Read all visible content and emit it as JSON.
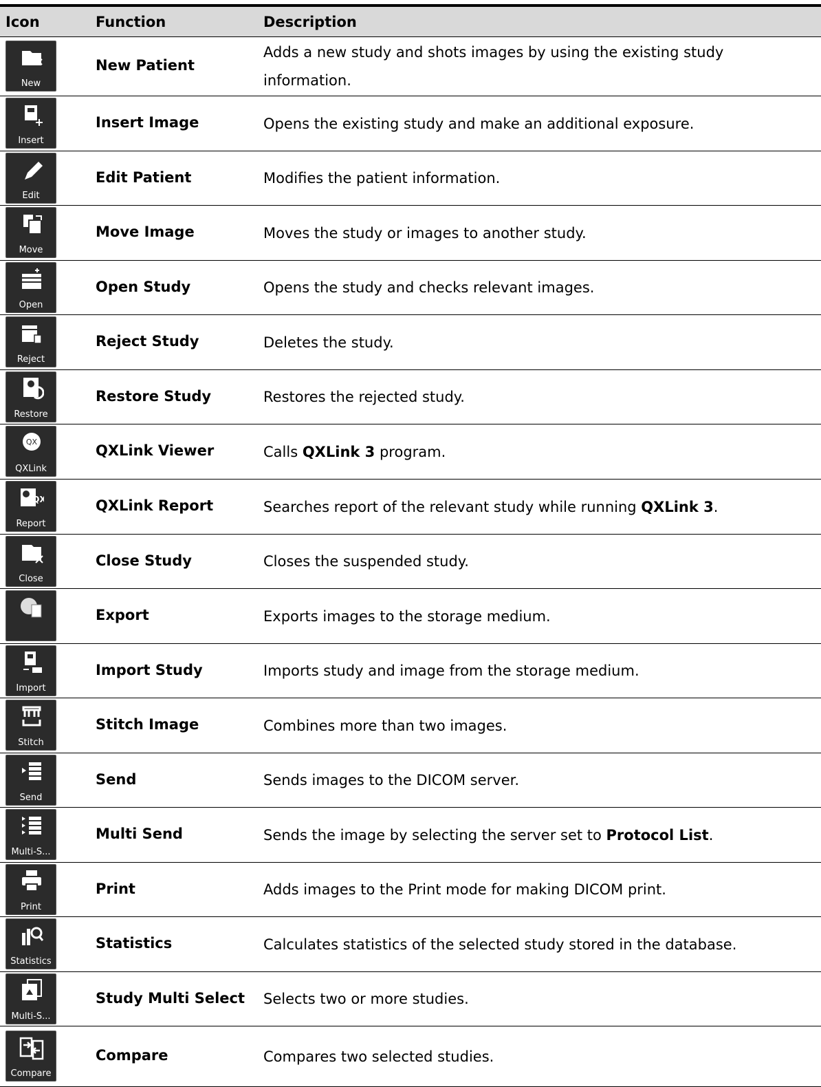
{
  "header": {
    "icon": "Icon",
    "function": "Function",
    "description": "Description"
  },
  "rows": [
    {
      "icon": "new-patient-icon",
      "icon_label": "New",
      "function": "New Patient",
      "desc": [
        {
          "t": "Adds a new study and shots images by using the existing study information.",
          "b": false
        }
      ]
    },
    {
      "icon": "insert-image-icon",
      "icon_label": "Insert",
      "function": "Insert Image",
      "desc": [
        {
          "t": "Opens the existing study and make an additional exposure.",
          "b": false
        }
      ]
    },
    {
      "icon": "edit-icon",
      "icon_label": "Edit",
      "function": "Edit Patient",
      "desc": [
        {
          "t": "Modifies the patient information.",
          "b": false
        }
      ]
    },
    {
      "icon": "move-image-icon",
      "icon_label": "Move",
      "function": "Move Image",
      "desc": [
        {
          "t": "Moves the study or images to another study.",
          "b": false
        }
      ]
    },
    {
      "icon": "open-study-icon",
      "icon_label": "Open",
      "function": "Open Study",
      "desc": [
        {
          "t": "Opens the study and checks relevant images.",
          "b": false
        }
      ]
    },
    {
      "icon": "reject-study-icon",
      "icon_label": "Reject",
      "function": "Reject Study",
      "desc": [
        {
          "t": "Deletes the study.",
          "b": false
        }
      ]
    },
    {
      "icon": "restore-study-icon",
      "icon_label": "Restore",
      "function": "Restore Study",
      "desc": [
        {
          "t": "Restores the rejected study.",
          "b": false
        }
      ]
    },
    {
      "icon": "qxlink-viewer-icon",
      "icon_label": "QXLink",
      "function": "QXLink Viewer",
      "desc": [
        {
          "t": "Calls ",
          "b": false
        },
        {
          "t": "QXLink 3",
          "b": true
        },
        {
          "t": " program.",
          "b": false
        }
      ]
    },
    {
      "icon": "qxlink-report-icon",
      "icon_label": "Report",
      "function": "QXLink Report",
      "desc": [
        {
          "t": "Searches report of the relevant study while running ",
          "b": false
        },
        {
          "t": "QXLink 3",
          "b": true
        },
        {
          "t": ".",
          "b": false
        }
      ]
    },
    {
      "icon": "close-study-icon",
      "icon_label": "Close",
      "function": "Close Study",
      "desc": [
        {
          "t": "Closes the suspended study.",
          "b": false
        }
      ]
    },
    {
      "icon": "export-icon",
      "icon_label": "",
      "function": "Export",
      "desc": [
        {
          "t": "Exports images to the storage medium.",
          "b": false
        }
      ]
    },
    {
      "icon": "import-study-icon",
      "icon_label": "Import",
      "function": "Import Study",
      "desc": [
        {
          "t": "Imports study and image from the storage medium.",
          "b": false
        }
      ]
    },
    {
      "icon": "stitch-image-icon",
      "icon_label": "Stitch",
      "function": "Stitch Image",
      "desc": [
        {
          "t": "Combines more than two images.",
          "b": false
        }
      ]
    },
    {
      "icon": "send-icon",
      "icon_label": "Send",
      "function": "Send",
      "desc": [
        {
          "t": "Sends images to the DICOM server.",
          "b": false
        }
      ]
    },
    {
      "icon": "multi-send-icon",
      "icon_label": "Multi-S...",
      "function": "Multi Send",
      "desc": [
        {
          "t": "Sends the image by selecting the server set to ",
          "b": false
        },
        {
          "t": "Protocol List",
          "b": true
        },
        {
          "t": ".",
          "b": false
        }
      ]
    },
    {
      "icon": "print-icon",
      "icon_label": "Print",
      "function": "Print",
      "desc": [
        {
          "t": "Adds images to the Print mode for making DICOM print.",
          "b": false
        }
      ]
    },
    {
      "icon": "statistics-icon",
      "icon_label": "Statistics",
      "function": "Statistics",
      "desc": [
        {
          "t": "Calculates statistics of the selected study stored in the database.",
          "b": false
        }
      ]
    },
    {
      "icon": "study-multi-select-icon",
      "icon_label": "Multi-S...",
      "function": "Study Multi Select",
      "desc": [
        {
          "t": "Selects two or more studies.",
          "b": false
        }
      ]
    },
    {
      "icon": "compare-icon",
      "icon_label": "Compare",
      "function": "Compare",
      "desc": [
        {
          "t": "Compares two selected studies.",
          "b": false
        }
      ]
    }
  ]
}
